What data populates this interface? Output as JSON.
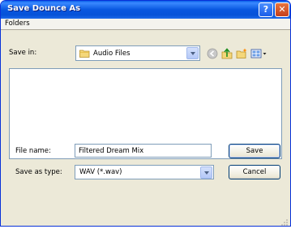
{
  "dialog": {
    "title": "Save Dounce As",
    "help_glyph": "?",
    "close_glyph": "✕"
  },
  "menu": {
    "folders": "Folders"
  },
  "save_in": {
    "label": "Save in:",
    "folder": "Audio Files"
  },
  "toolbar_icons": [
    "back-icon",
    "up-folder-icon",
    "new-folder-icon",
    "views-menu-icon"
  ],
  "file_name": {
    "label": "File name:",
    "value": "Filtered Dream Mix"
  },
  "save_as_type": {
    "label": "Save as type:",
    "value": "WAV (*.wav)"
  },
  "buttons": {
    "save": "Save",
    "cancel": "Cancel"
  },
  "colors": {
    "titlebar": "#0857e0",
    "face": "#ece9d8",
    "border": "#7f9db9"
  }
}
